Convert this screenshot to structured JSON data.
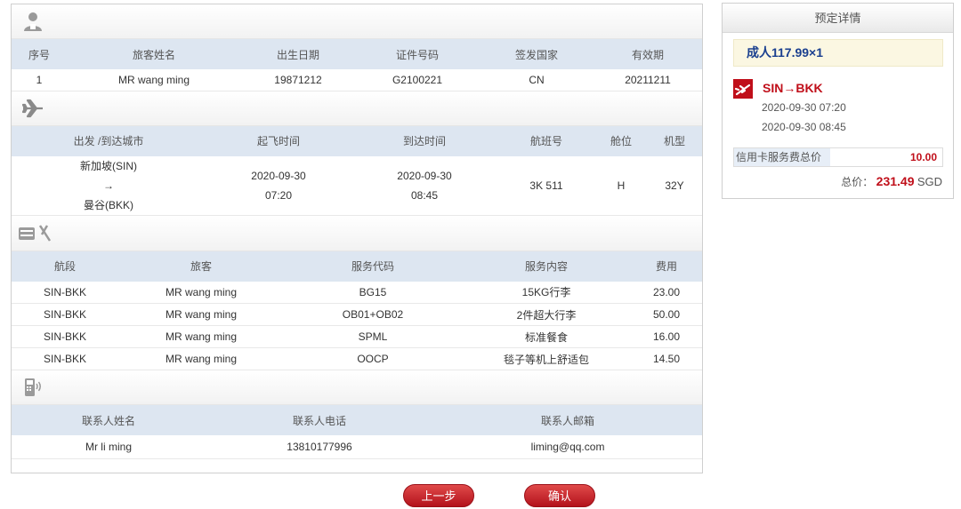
{
  "passenger_section": {
    "icon": "user-icon",
    "headers": [
      "序号",
      "旅客姓名",
      "出生日期",
      "证件号码",
      "签发国家",
      "有效期"
    ],
    "rows": [
      [
        "1",
        "MR wang ming",
        "19871212",
        "G2100221",
        "CN",
        "20211211"
      ]
    ]
  },
  "flight_section": {
    "icon": "airplane-icon",
    "headers": [
      "出发 /到达城市",
      "起飞时间",
      "到达时间",
      "航班号",
      "舱位",
      "机型"
    ],
    "row": {
      "from_city": "新加坡(SIN)",
      "arrow": "→",
      "to_city": "曼谷(BKK)",
      "dep_date": "2020-09-30",
      "dep_time": "07:20",
      "arr_date": "2020-09-30",
      "arr_time": "08:45",
      "flight_no": "3K 511",
      "cabin": "H",
      "aircraft": "32Y"
    }
  },
  "service_section": {
    "icon": "luggage-meal-icon",
    "headers": [
      "航段",
      "旅客",
      "服务代码",
      "服务内容",
      "费用"
    ],
    "rows": [
      [
        "SIN-BKK",
        "MR wang ming",
        "BG15",
        "15KG行李",
        "23.00"
      ],
      [
        "SIN-BKK",
        "MR wang ming",
        "OB01+OB02",
        "2件超大行李",
        "50.00"
      ],
      [
        "SIN-BKK",
        "MR wang ming",
        "SPML",
        "标准餐食",
        "16.00"
      ],
      [
        "SIN-BKK",
        "MR wang ming",
        "OOCP",
        "毯子等机上舒适包",
        "14.50"
      ]
    ]
  },
  "contact_section": {
    "icon": "phone-icon",
    "headers": [
      "联系人姓名",
      "联系人电话",
      "联系人邮箱"
    ],
    "row": [
      "Mr li ming",
      "13810177996",
      "liming@qq.com"
    ]
  },
  "booking_details": {
    "title": "预定详情",
    "adult_price": "成人117.99×1",
    "route": "SIN→BKK",
    "departure": "2020-09-30 07:20",
    "arrival": "2020-09-30 08:45",
    "fee_label": "信用卡服务费总价",
    "fee_value": "10.00",
    "total_label": "总价：",
    "total_value": "231.49",
    "currency": "SGD"
  },
  "buttons": {
    "prev": "上一步",
    "confirm": "确认"
  },
  "colors": {
    "accent_red": "#c00f1a",
    "header_bg": "#dde6f1",
    "price_blue": "#1a3f8f"
  }
}
